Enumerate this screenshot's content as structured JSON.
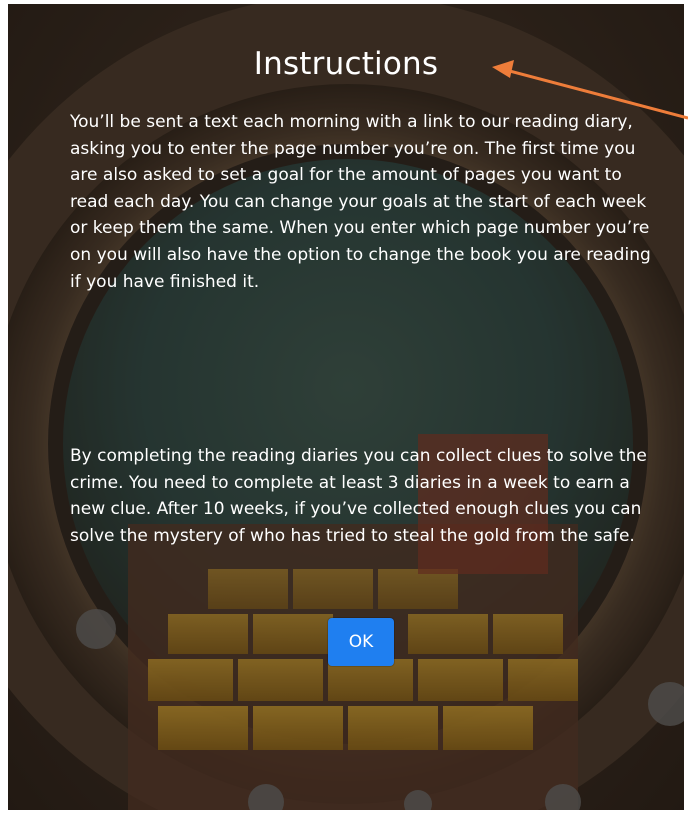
{
  "dialog": {
    "title": "Instructions",
    "paragraphs": [
      "You’ll be sent a text each morning with a link to our reading diary, asking you to enter the page number you’re on. The first time you are also asked to set a goal for the amount of pages you want to read each day. You can change your goals at the start of each week or keep them the same. When you enter which page number you’re on you will also have the option to change the book you are reading if you have finished it.",
      "By completing the reading diaries you can collect clues to solve the crime. You need to complete at least 3 diaries in a week to earn a new clue. After 10 weeks, if you’ve collected enough clues you can solve the mystery of who has tried to steal the gold from the safe."
    ],
    "ok_label": "OK"
  },
  "colors": {
    "button": "#1f7ff0",
    "annotation_arrow": "#ee7d3a",
    "text": "#ffffff",
    "background": "#3d2f25"
  },
  "icons": {
    "annotation": "arrow-left-icon",
    "background": "vault-door-gold-illustration"
  }
}
